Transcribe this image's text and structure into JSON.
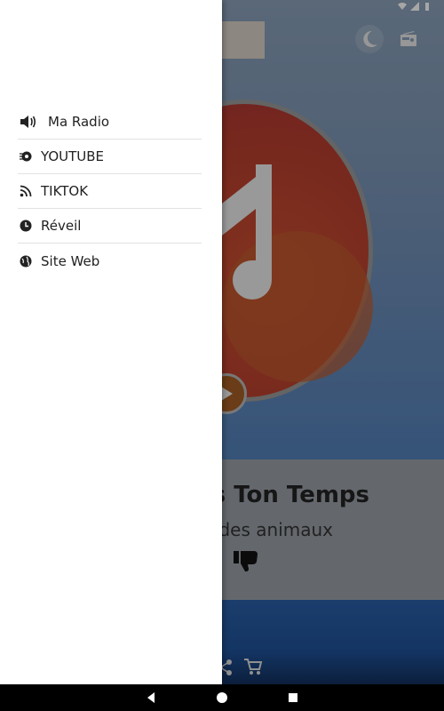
{
  "menu": {
    "items": [
      {
        "label": "Ma Radio",
        "icon": "speaker-icon"
      },
      {
        "label": "YOUTUBE",
        "icon": "youtube-icon"
      },
      {
        "label": "TIKTOK",
        "icon": "rss-icon"
      },
      {
        "label": "Réveil",
        "icon": "clock-icon"
      },
      {
        "label": "Site Web",
        "icon": "globe-icon"
      }
    ]
  },
  "player": {
    "title": "s Ton Temps",
    "artist": "des animaux"
  },
  "colors": {
    "drawer_bg": "#ffffff",
    "disc": "#b73e2f",
    "play_button": "#a35c24",
    "bottom_band": "#1f5299"
  }
}
